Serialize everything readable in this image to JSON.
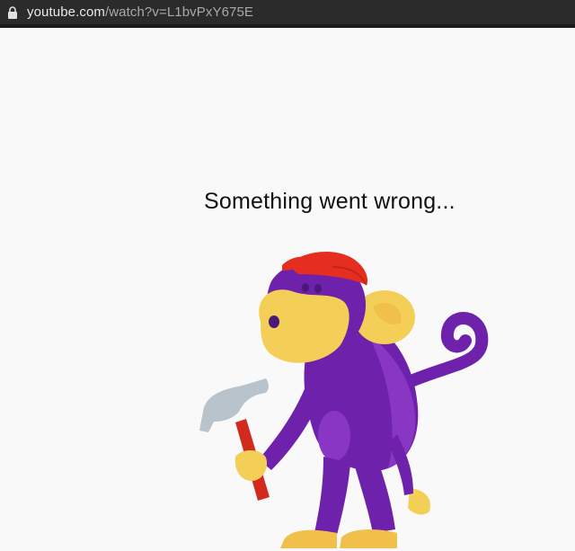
{
  "address_bar": {
    "host": "youtube.com",
    "path": "/watch?v=L1bvPxY675E",
    "icon": "lock-icon"
  },
  "error": {
    "title": "Something went wrong...",
    "illustration": "monkey-with-hammer-illustration"
  },
  "colors": {
    "fur": "#6e22ab",
    "fur_light": "#8a36c4",
    "face": "#f4cf57",
    "cap": "#e62e20",
    "hammer_head": "#b8c3cc",
    "hammer_handle": "#d32a1e"
  }
}
